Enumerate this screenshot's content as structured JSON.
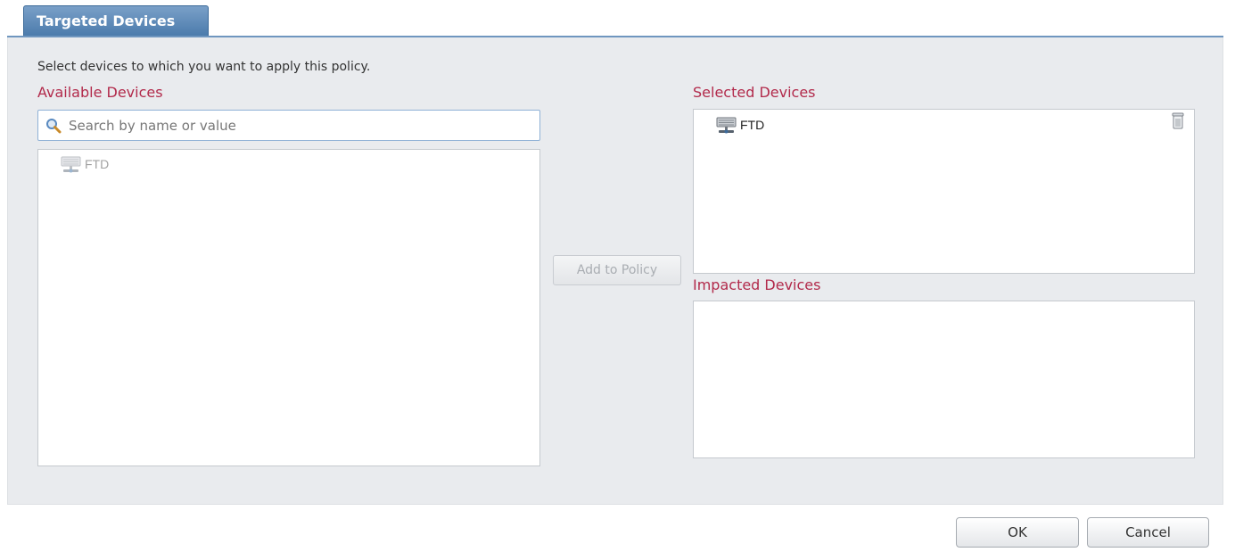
{
  "tab": {
    "label": "Targeted Devices"
  },
  "instructions": "Select devices to which you want to apply this policy.",
  "available": {
    "label": "Available Devices",
    "search_placeholder": "Search by name or value",
    "items": [
      {
        "label": "FTD",
        "icon": "device-icon"
      }
    ]
  },
  "add_button_label": "Add to Policy",
  "selected": {
    "label": "Selected Devices",
    "items": [
      {
        "label": "FTD",
        "icon": "device-icon"
      }
    ]
  },
  "impacted": {
    "label": "Impacted Devices",
    "items": []
  },
  "footer": {
    "ok_label": "OK",
    "cancel_label": "Cancel"
  },
  "colors": {
    "tab_blue": "#4a7aab",
    "label_red": "#b22a4b",
    "panel_bg": "#e9ebee"
  }
}
